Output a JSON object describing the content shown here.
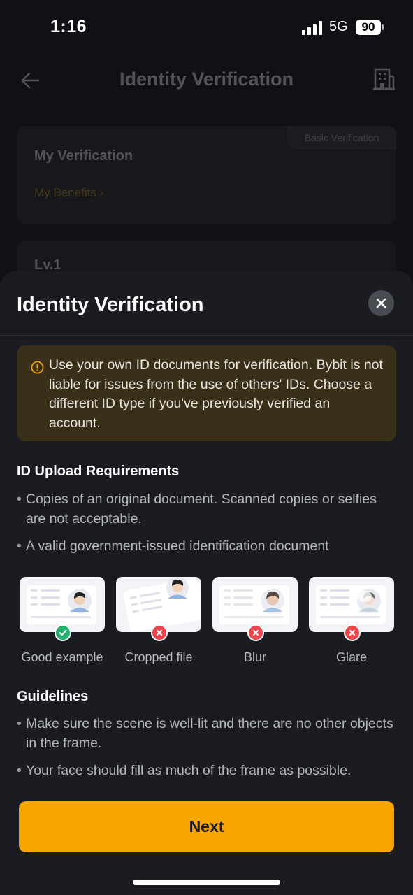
{
  "status_bar": {
    "time": "1:16",
    "network": "5G",
    "battery": "90"
  },
  "background": {
    "nav_title": "Identity Verification",
    "card_badge": "Basic Verification",
    "card_title": "My Verification",
    "card_link": "My Benefits",
    "level_title": "Lv.1"
  },
  "sheet": {
    "title": "Identity Verification",
    "warning": "Use your own ID documents for verification. Bybit is not liable for issues from the use of others' IDs. Choose a different ID type if you've previously verified an account.",
    "upload_title": "ID Upload Requirements",
    "upload_bullets": [
      "Copies of an original document. Scanned copies or selfies are not acceptable.",
      "A valid government-issued identification document"
    ],
    "examples": [
      {
        "label": "Good example",
        "status": "ok"
      },
      {
        "label": "Cropped file",
        "status": "bad"
      },
      {
        "label": "Blur",
        "status": "bad"
      },
      {
        "label": "Glare",
        "status": "bad"
      }
    ],
    "guidelines_title": "Guidelines",
    "guideline_bullets": [
      "Make sure the scene is well-lit and there are no other objects in the frame.",
      "Your face should fill as much of the frame as possible."
    ],
    "next_label": "Next"
  },
  "colors": {
    "accent": "#f7a600",
    "ok": "#20b26c",
    "bad": "#f0424a",
    "warning_bg": "#3a301a"
  }
}
